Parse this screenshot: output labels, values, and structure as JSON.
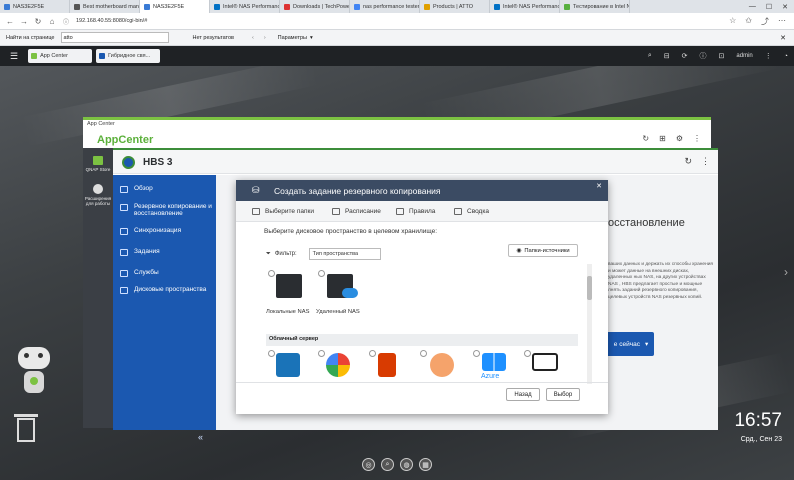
{
  "browser": {
    "tabs": [
      {
        "label": "NAS3E2F5E",
        "color": "#3a7bd5",
        "active": false
      },
      {
        "label": "Best motherboard man",
        "color": "#555555",
        "active": false
      },
      {
        "label": "NAS3E2F5E",
        "color": "#3a7bd5",
        "active": true
      },
      {
        "label": "Intel® NAS Performanc",
        "color": "#0071c5",
        "active": false
      },
      {
        "label": "Downloads | TechPower",
        "color": "#d33",
        "active": false
      },
      {
        "label": "nas performance tester",
        "color": "#4285f4",
        "active": false
      },
      {
        "label": "Products | ATTO",
        "color": "#e0a000",
        "active": false
      },
      {
        "label": "Intel® NAS Performanc",
        "color": "#0071c5",
        "active": false
      },
      {
        "label": "Тестирование в Intel N",
        "color": "#58b040",
        "active": false
      }
    ],
    "url": "192.168.40.55:8080/cgi-bin/#",
    "find": {
      "label": "Найти на странице",
      "value": "atto",
      "no_results": "Нет результатов",
      "params": "Параметры"
    }
  },
  "qts": {
    "tabs": [
      "App Center",
      "Гибридное свя..."
    ],
    "user": "admin"
  },
  "appcenter": {
    "window_title": "App Center",
    "logo": "AppCenter"
  },
  "store_strip": {
    "store": "QNAP Store",
    "ext": "Расширения для работы"
  },
  "hbs": {
    "title": "HBS 3",
    "nav": [
      "Обзор",
      "Резервное копирование и восстановление",
      "Синхронизация",
      "Задания",
      "Службы",
      "Дисковые пространства"
    ],
    "bg_heading": "осстановление",
    "bg_text": "ваших данных и держать их способы хранения и может данные на внешних дисках, удаленных ных NAS, на других устройствах NAS , HBS предлагает простые и мощные лнять заданий резервного копирования, целевых устройств NAS резервных копий.",
    "bg_button": "е сейчас"
  },
  "modal": {
    "title": "Создать задание резервного копирования",
    "steps": [
      "Выберите папки",
      "Расписание",
      "Правила",
      "Сводка"
    ],
    "prompt": "Выберите дисковое пространство в целевом хранилище:",
    "filter_label": "Фильтр:",
    "filter_value": "Тип пространства",
    "source_button": "Папки-источники",
    "nas_local": "Локальные NAS",
    "nas_remote": "Удаленный NAS",
    "cloud_header": "Облачный сервер",
    "cloud_providers": [
      "amazon-icon",
      "google-cloud-icon",
      "office365-icon",
      "cloud-drive-icon",
      "azure-icon",
      "box-icon"
    ],
    "azure_label": "Azure",
    "back": "Назад",
    "select": "Выбор"
  },
  "desktop": {
    "time": "16:57",
    "date": "Срд., Сен 23"
  },
  "colors": {
    "accent_blue": "#1b58b0",
    "accent_green": "#7cc242",
    "modal_header": "#3b4b63"
  }
}
